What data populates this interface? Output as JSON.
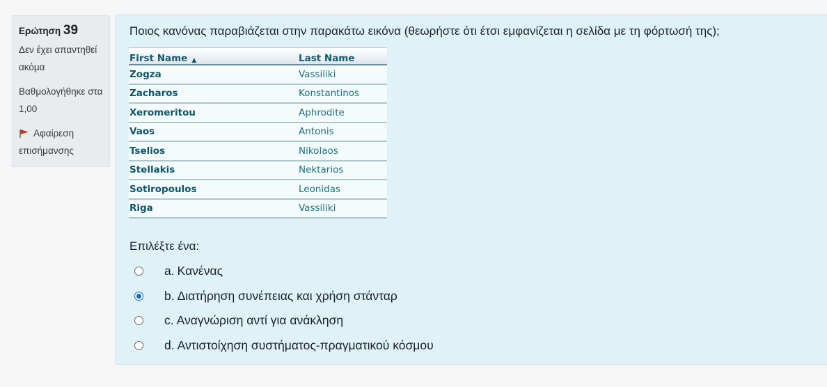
{
  "info": {
    "question_label": "Ερώτηση",
    "question_number": "39",
    "state": "Δεν έχει απαντηθεί ακόμα",
    "grade": "Βαθμολογήθηκε στα 1,00",
    "flag_label": "Αφαίρεση επισήμανσης",
    "flag_icon": "flag-icon"
  },
  "question": {
    "text": "Ποιος κανόνας παραβιάζεται στην παρακάτω εικόνα (θεωρήστε ότι έτσι εμφανίζεται η σελίδα με τη φόρτωσή της);",
    "table": {
      "headers": [
        "First Name",
        "Last Name"
      ],
      "sort_indicator": "▲",
      "rows": [
        [
          "Zogza",
          "Vassiliki"
        ],
        [
          "Zacharos",
          "Konstantinos"
        ],
        [
          "Xeromeritou",
          "Aphrodite"
        ],
        [
          "Vaos",
          "Antonis"
        ],
        [
          "Tselios",
          "Nikolaos"
        ],
        [
          "Stellakis",
          "Nektarios"
        ],
        [
          "Sotiropoulos",
          "Leonidas"
        ],
        [
          "Riga",
          "Vassiliki"
        ]
      ]
    },
    "prompt": "Επιλέξτε ένα:",
    "answers": [
      {
        "letter": "a.",
        "text": "Κανένας",
        "checked": false
      },
      {
        "letter": "b.",
        "text": "Διατήρηση συνέπειας και χρήση στάνταρ",
        "checked": true
      },
      {
        "letter": "c.",
        "text": "Αναγνώριση αντί για ανάκληση",
        "checked": false
      },
      {
        "letter": "d.",
        "text": "Αντιστοίχηση συστήματος-πραγματικού κόσμου",
        "checked": false
      }
    ]
  },
  "colors": {
    "content_bg": "#def2f8",
    "info_bg": "#e9ecef",
    "accent": "#0f6cbf",
    "flag": "#c0392b"
  }
}
